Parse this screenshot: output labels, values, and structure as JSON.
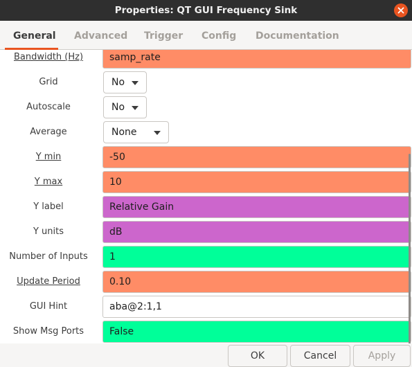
{
  "window": {
    "title": "Properties: QT GUI Frequency Sink",
    "close_icon": "close-icon",
    "accent_color": "#e95420"
  },
  "tabs": [
    {
      "label": "General",
      "active": true
    },
    {
      "label": "Advanced",
      "active": false
    },
    {
      "label": "Trigger",
      "active": false
    },
    {
      "label": "Config",
      "active": false
    },
    {
      "label": "Documentation",
      "active": false
    }
  ],
  "fields": {
    "bandwidth": {
      "label": "Bandwidth (Hz)",
      "value": "samp_rate",
      "color": "#ff8c66"
    },
    "grid": {
      "label": "Grid",
      "value": "No"
    },
    "autoscale": {
      "label": "Autoscale",
      "value": "No"
    },
    "average": {
      "label": "Average",
      "value": "None"
    },
    "ymin": {
      "label": "Y min",
      "value": "-50",
      "color": "#ff8c66"
    },
    "ymax": {
      "label": "Y max",
      "value": "10",
      "color": "#ff8c66"
    },
    "ylabel": {
      "label": "Y label",
      "value": "Relative Gain",
      "color": "#cc66cc"
    },
    "yunits": {
      "label": "Y units",
      "value": "dB",
      "color": "#cc66cc"
    },
    "num_inputs": {
      "label": "Number of Inputs",
      "value": "1",
      "color": "#00ff99"
    },
    "update_period": {
      "label": "Update Period",
      "value": "0.10",
      "color": "#ff8c66"
    },
    "gui_hint": {
      "label": "GUI Hint",
      "value": "aba@2:1,1",
      "color": "#ffffff"
    },
    "show_msg_ports": {
      "label": "Show Msg Ports",
      "value": "False",
      "color": "#00ff99"
    }
  },
  "buttons": {
    "ok": "OK",
    "cancel": "Cancel",
    "apply": "Apply"
  }
}
